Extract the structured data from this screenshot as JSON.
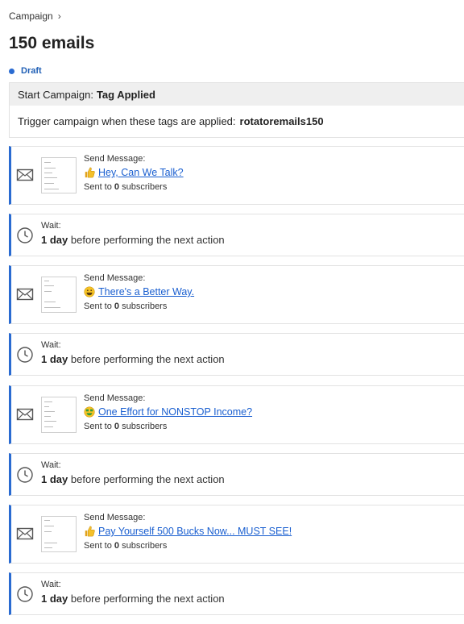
{
  "breadcrumb": {
    "parent": "Campaign",
    "separator_icon": "chevron-right-icon"
  },
  "page": {
    "title": "150 emails"
  },
  "status": {
    "label": "Draft",
    "color": "#2a6bd1"
  },
  "trigger": {
    "heading_prefix": "Start Campaign:",
    "heading_value": "Tag Applied",
    "description": "Trigger campaign when these tags are applied:",
    "tag": "rotatoremails150"
  },
  "steps": [
    {
      "type": "message",
      "label": "Send Message:",
      "emoji": "thumbs-up",
      "subject": "Hey, Can We Talk?",
      "sent_prefix": "Sent to",
      "sent_count": "0",
      "sent_suffix": "subscribers"
    },
    {
      "type": "wait",
      "label": "Wait:",
      "duration": "1 day",
      "suffix": "before performing the next action"
    },
    {
      "type": "message",
      "label": "Send Message:",
      "emoji": "grinning-face",
      "subject": "There's a Better Way.",
      "sent_prefix": "Sent to",
      "sent_count": "0",
      "sent_suffix": "subscribers"
    },
    {
      "type": "wait",
      "label": "Wait:",
      "duration": "1 day",
      "suffix": "before performing the next action"
    },
    {
      "type": "message",
      "label": "Send Message:",
      "emoji": "money-mouth-face",
      "subject": "One Effort for NONSTOP Income?",
      "sent_prefix": "Sent to",
      "sent_count": "0",
      "sent_suffix": "subscribers"
    },
    {
      "type": "wait",
      "label": "Wait:",
      "duration": "1 day",
      "suffix": "before performing the next action"
    },
    {
      "type": "message",
      "label": "Send Message:",
      "emoji": "thumbs-up",
      "subject": "Pay Yourself 500 Bucks Now... MUST SEE!",
      "sent_prefix": "Sent to",
      "sent_count": "0",
      "sent_suffix": "subscribers"
    },
    {
      "type": "wait",
      "label": "Wait:",
      "duration": "1 day",
      "suffix": "before performing the next action"
    }
  ],
  "colors": {
    "accent": "#2a6bd1",
    "link": "#1a5fd0"
  }
}
